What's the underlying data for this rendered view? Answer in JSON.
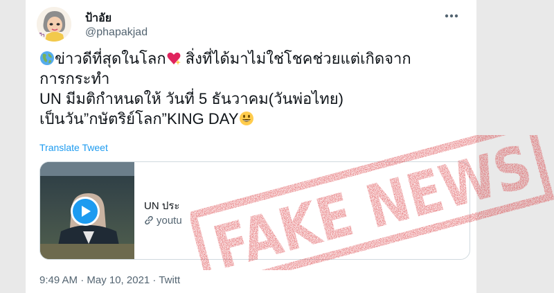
{
  "tweet": {
    "author": {
      "display_name": "ป้าอัย",
      "handle": "@phapakjad"
    },
    "text_lines": [
      "ข่าวดีที่สุดในโลก",
      " สิ่งที่ได้มาไม่ใช่โชคช่วยแต่เกิดจาก",
      "การกระทำ",
      "UN มีมติกำหนดให้ วันที่ 5 ธันวาคม(วันพ่อไทย)",
      "เป็นวัน”กษัตริย์โลก”KING DAY"
    ],
    "translate_label": "Translate Tweet",
    "link_card": {
      "title": "UN ประ",
      "source": "youtu"
    },
    "timestamp": "9:49 AM · May 10, 2021 · Twitt"
  },
  "overlay": {
    "stamp_text": "FAKE NEWS",
    "stamp_color": "#d6262b"
  },
  "colors": {
    "link": "#1d9bf0",
    "text": "#0f1419",
    "muted": "#536471"
  }
}
